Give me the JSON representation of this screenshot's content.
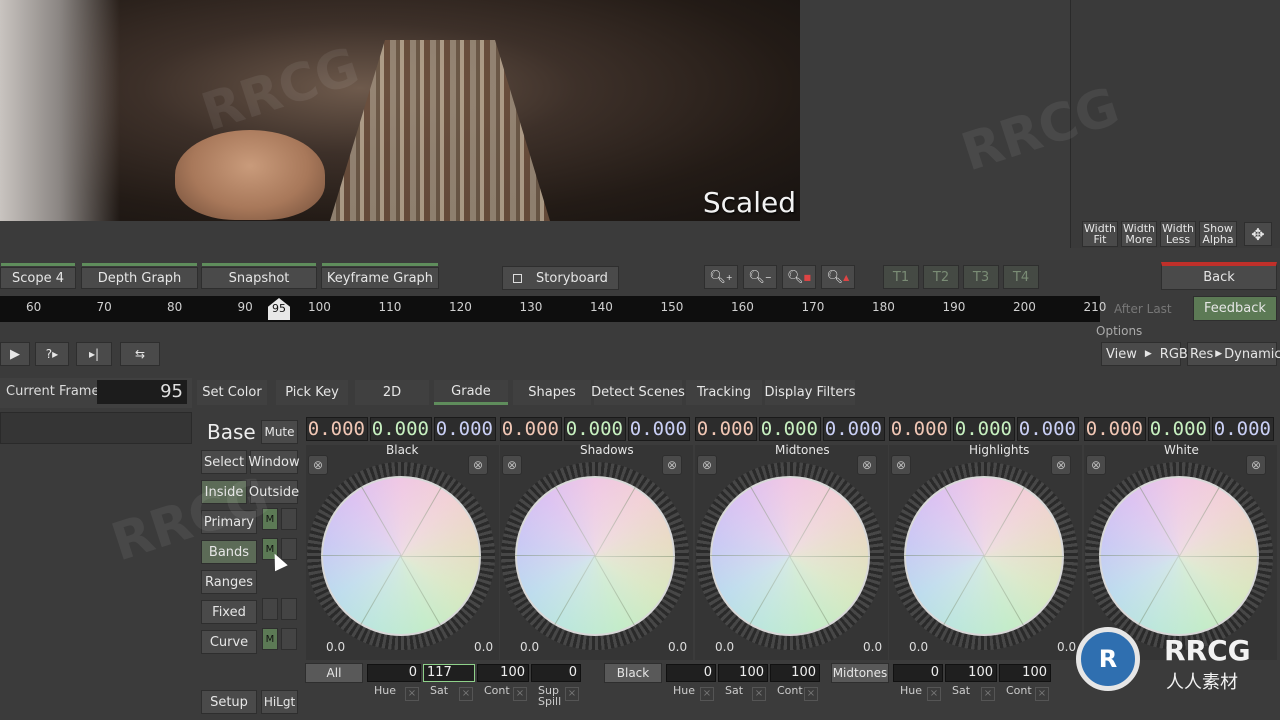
{
  "viewer": {
    "overlay_text": "Scaled"
  },
  "right_panel": {
    "buttons": [
      {
        "line1": "Width",
        "line2": "Fit"
      },
      {
        "line1": "Width",
        "line2": "More"
      },
      {
        "line1": "Width",
        "line2": "Less"
      },
      {
        "line1": "Show",
        "line2": "Alpha"
      }
    ],
    "move_icon": "move-icon"
  },
  "top_tabs": [
    "Scope 4",
    "Depth Graph",
    "Snapshot",
    "Keyframe Graph"
  ],
  "storyboard_label": "Storyboard",
  "track_buttons": [
    "T1",
    "T2",
    "T3",
    "T4"
  ],
  "back_label": "Back",
  "feedback_label": "Feedback",
  "after_last_label": "After Last",
  "options_label": "Options",
  "timeline": {
    "ticks": [
      "60",
      "70",
      "80",
      "90",
      "100",
      "110",
      "120",
      "130",
      "140",
      "150",
      "160",
      "170",
      "180",
      "190",
      "200",
      "210"
    ],
    "current": "95"
  },
  "view_controls": {
    "view_label": "View",
    "view_value": "RGB",
    "res_label": "Res",
    "res_value": "Dynamic"
  },
  "current_frame": {
    "label": "Current Frame",
    "value": "95"
  },
  "mode_tabs": [
    "Set Color",
    "Pick Key",
    "2D",
    "Grade",
    "Shapes",
    "Detect Scenes",
    "Tracking",
    "Display Filters"
  ],
  "active_mode_tab": "Grade",
  "left_controls": {
    "base": "Base",
    "mute": "Mute",
    "select": "Select",
    "window": "Window",
    "inside": "Inside",
    "outside": "Outside",
    "primary": "Primary",
    "bands": "Bands",
    "ranges": "Ranges",
    "fixed": "Fixed",
    "curve": "Curve",
    "setup": "Setup",
    "hilgt": "HiLgt",
    "m": "M"
  },
  "rgb_values": [
    "0.000",
    "0.000",
    "0.000",
    "0.000",
    "0.000",
    "0.000",
    "0.000",
    "0.000",
    "0.000",
    "0.000",
    "0.000",
    "0.000",
    "0.000",
    "0.000",
    "0.000"
  ],
  "wheels": [
    {
      "name": "Black",
      "left_val": "0.0",
      "right_val": "0.0"
    },
    {
      "name": "Shadows",
      "left_val": "0.0",
      "right_val": "0.0"
    },
    {
      "name": "Midtones",
      "left_val": "0.0",
      "right_val": "0.0"
    },
    {
      "name": "Highlights",
      "left_val": "0.0",
      "right_val": "0.0"
    },
    {
      "name": "White",
      "left_val": "",
      "right_val": ""
    }
  ],
  "strips": [
    {
      "label": "All",
      "fields": [
        "0",
        "117",
        "100",
        "0"
      ],
      "sublabels": [
        "Hue",
        "Sat",
        "Cont",
        "Sup Spill"
      ]
    },
    {
      "label": "Black",
      "fields": [
        "0",
        "100",
        "100"
      ],
      "sublabels": [
        "Hue",
        "Sat",
        "Cont"
      ]
    },
    {
      "label": "Midtones",
      "fields": [
        "0",
        "100",
        "100"
      ],
      "sublabels": [
        "Hue",
        "Sat",
        "Cont"
      ]
    }
  ],
  "watermark": {
    "text": "RRCG",
    "sub": "人人素材"
  },
  "colors": {
    "accent_green": "#5f8d5c",
    "back_red": "#c0302a",
    "active_btn": "#5c6b57"
  }
}
